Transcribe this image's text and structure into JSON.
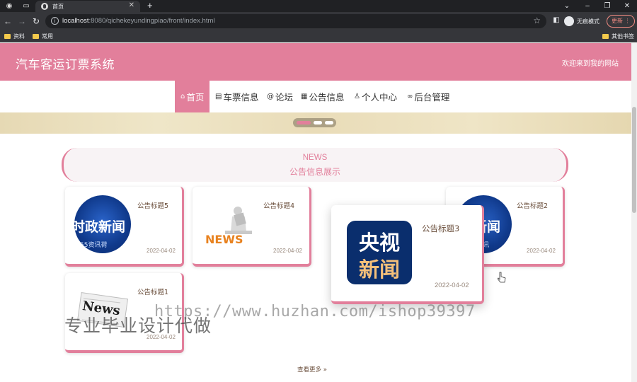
{
  "browser": {
    "tab_title": "首页",
    "url_host": "localhost",
    "url_rest": ":8080/qichekeyundingpiao/front/index.html",
    "profile_label": "无痕模式",
    "update_label": "更新",
    "bookmarks": [
      "资料",
      "常用"
    ],
    "other_bookmarks": "其他书签"
  },
  "site": {
    "title": "汽车客运订票系统",
    "welcome": "欢迎来到我的网站"
  },
  "nav": [
    {
      "label": "首页",
      "icon": "home-icon"
    },
    {
      "label": "车票信息",
      "icon": "ticket-icon"
    },
    {
      "label": "论坛",
      "icon": "at-icon"
    },
    {
      "label": "公告信息",
      "icon": "document-icon"
    },
    {
      "label": "个人中心",
      "icon": "user-icon"
    },
    {
      "label": "后台管理",
      "icon": "link-icon"
    }
  ],
  "news": {
    "heading_en": "NEWS",
    "heading_cn": "公告信息展示",
    "more_label": "查看更多"
  },
  "cards": [
    {
      "title": "公告标题5",
      "date": "2022-04-02",
      "thumb_lines": [
        "时政新闻",
        "55资讯荷"
      ]
    },
    {
      "title": "公告标题4",
      "date": "2022-04-02",
      "thumb_text": "NEWS"
    },
    {
      "title": "公告标题3",
      "date": "2022-04-02",
      "thumb_lines": [
        "央视",
        "新闻"
      ]
    },
    {
      "title": "公告标题2",
      "date": "2022-04-02",
      "thumb_lines": [
        "新闻",
        "资讯"
      ]
    },
    {
      "title": "公告标题1",
      "date": "2022-04-02",
      "thumb_text": "News"
    }
  ],
  "overlay": {
    "watermark_url": "https://www.huzhan.com/ishop39397",
    "watermark_cn": "专业毕业设计代做"
  },
  "colors": {
    "brand": "#e27f9b",
    "browser_dark": "#202124",
    "browser_toolbar": "#35363a"
  }
}
